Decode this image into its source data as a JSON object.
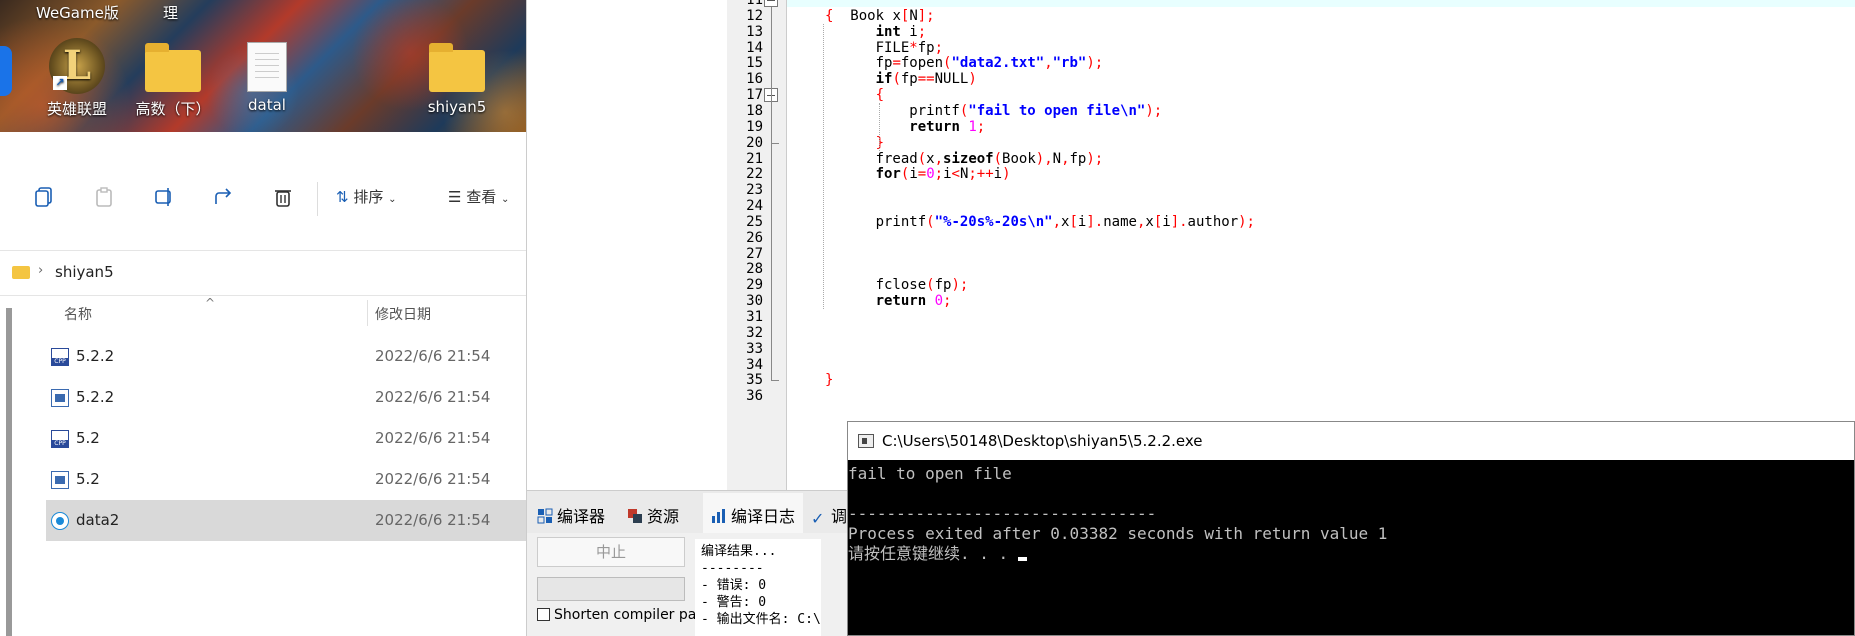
{
  "desktop": {
    "top_labels": [
      "WeGame版",
      "理"
    ],
    "icons": [
      {
        "label": "英雄联盟",
        "kind": "lol"
      },
      {
        "label": "高数（下）",
        "kind": "folder"
      },
      {
        "label": "datal",
        "kind": "document"
      },
      {
        "label": "shiyan5",
        "kind": "folder"
      }
    ]
  },
  "explorer": {
    "toolbar": {
      "sort_label": "排序",
      "view_label": "查看",
      "icons": [
        "copy-icon",
        "paste-icon",
        "rename-icon",
        "share-icon",
        "delete-icon"
      ]
    },
    "address": {
      "path": "shiyan5"
    },
    "columns": {
      "name": "名称",
      "modified": "修改日期"
    },
    "files": [
      {
        "name": "5.2.2",
        "type": "cpp",
        "date": "2022/6/6 21:54"
      },
      {
        "name": "5.2.2",
        "type": "exe",
        "date": "2022/6/6 21:54"
      },
      {
        "name": "5.2",
        "type": "cpp",
        "date": "2022/6/6 21:54"
      },
      {
        "name": "5.2",
        "type": "exe",
        "date": "2022/6/6 21:54"
      },
      {
        "name": "data2",
        "type": "data",
        "date": "2022/6/6 21:54",
        "selected": true
      }
    ]
  },
  "editor": {
    "first_line": 11,
    "lines": [
      {
        "n": "11",
        "html": ""
      },
      {
        "n": "12",
        "html": "<span class=\"op\">{</span>  Book x<span class=\"op\">[</span>N<span class=\"op\">];</span>"
      },
      {
        "n": "13",
        "html": "      <span class=\"kw\">int</span> i<span class=\"op\">;</span>"
      },
      {
        "n": "14",
        "html": "      FILE<span class=\"op\">*</span>fp<span class=\"op\">;</span>"
      },
      {
        "n": "15",
        "html": "      fp<span class=\"op\">=</span>fopen<span class=\"op\">(</span><span class=\"str\">\"data2.txt\"</span><span class=\"op\">,</span><span class=\"str\">\"rb\"</span><span class=\"op\">);</span>"
      },
      {
        "n": "16",
        "html": "      <span class=\"kw\">if</span><span class=\"op\">(</span>fp<span class=\"op\">==</span>NULL<span class=\"op\">)</span>"
      },
      {
        "n": "17",
        "html": "      <span class=\"op\">{</span>"
      },
      {
        "n": "18",
        "html": "          printf<span class=\"op\">(</span><span class=\"str\">\"fail to open file\\n\"</span><span class=\"op\">);</span>"
      },
      {
        "n": "19",
        "html": "          <span class=\"kw\">return</span> <span class=\"num\">1</span><span class=\"op\">;</span>"
      },
      {
        "n": "20",
        "html": "      <span class=\"op\">}</span>"
      },
      {
        "n": "21",
        "html": "      fread<span class=\"op\">(</span>x<span class=\"op\">,</span><span class=\"kw\">sizeof</span><span class=\"op\">(</span>Book<span class=\"op\">),</span>N<span class=\"op\">,</span>fp<span class=\"op\">);</span>"
      },
      {
        "n": "22",
        "html": "      <span class=\"kw\">for</span><span class=\"op\">(</span>i<span class=\"op\">=</span><span class=\"num\">0</span><span class=\"op\">;</span>i<span class=\"op\">&lt;</span>N<span class=\"op\">;++</span>i<span class=\"op\">)</span>"
      },
      {
        "n": "23",
        "html": ""
      },
      {
        "n": "24",
        "html": ""
      },
      {
        "n": "25",
        "html": "      printf<span class=\"op\">(</span><span class=\"str\">\"%-20s%-20s\\n\"</span><span class=\"op\">,</span>x<span class=\"op\">[</span>i<span class=\"op\">].</span>name<span class=\"op\">,</span>x<span class=\"op\">[</span>i<span class=\"op\">].</span>author<span class=\"op\">);</span>"
      },
      {
        "n": "26",
        "html": ""
      },
      {
        "n": "27",
        "html": ""
      },
      {
        "n": "28",
        "html": ""
      },
      {
        "n": "29",
        "html": "      fclose<span class=\"op\">(</span>fp<span class=\"op\">);</span>"
      },
      {
        "n": "30",
        "html": "      <span class=\"kw\">return</span> <span class=\"num\">0</span><span class=\"op\">;</span>"
      },
      {
        "n": "31",
        "html": ""
      },
      {
        "n": "32",
        "html": ""
      },
      {
        "n": "33",
        "html": ""
      },
      {
        "n": "34",
        "html": ""
      },
      {
        "n": "35",
        "html": "<span class=\"op\">}</span>"
      },
      {
        "n": "36",
        "html": ""
      }
    ]
  },
  "bottom_panel": {
    "tabs": [
      {
        "label": "编译器",
        "icon": "grid-icon"
      },
      {
        "label": "资源",
        "icon": "resources-icon"
      },
      {
        "label": "编译日志",
        "icon": "chart-icon"
      },
      {
        "label": "调",
        "icon": "check-icon"
      }
    ],
    "stop_button": "中止",
    "progress": 0,
    "shorten_checkbox": "Shorten compiler pa",
    "log_lines": [
      "编译结果...",
      "--------",
      "- 错误: 0",
      "- 警告: 0",
      "- 输出文件名: C:\\"
    ]
  },
  "console": {
    "title": "C:\\Users\\50148\\Desktop\\shiyan5\\5.2.2.exe",
    "lines": [
      "fail to open file",
      "",
      "--------------------------------",
      "Process exited after 0.03382 seconds with return value 1",
      "请按任意键继续. . . "
    ]
  },
  "colors": {
    "selection": "#d9d9d9",
    "console_bg": "#000000",
    "console_fg": "#c0c0c0",
    "code_string": "#0000ff",
    "code_operator": "#ff0000",
    "code_number": "#ff00ff"
  }
}
